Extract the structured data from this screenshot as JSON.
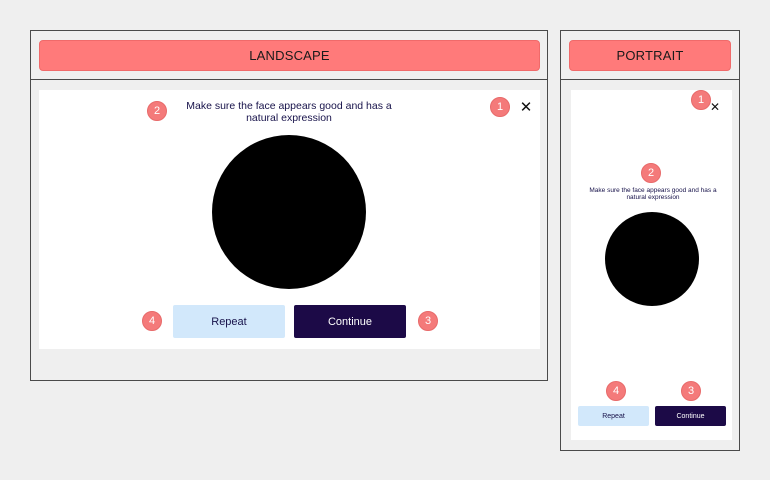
{
  "landscape": {
    "header_label": "LANDSCAPE",
    "close_glyph": "✕",
    "prompt": "Make sure the face appears good and has a natural expression",
    "repeat_label": "Repeat",
    "continue_label": "Continue",
    "markers": {
      "close": "1",
      "prompt": "2",
      "continue": "3",
      "repeat": "4"
    }
  },
  "portrait": {
    "header_label": "PORTRAIT",
    "close_glyph": "✕",
    "prompt": "Make sure the face appears good and has a natural expression",
    "repeat_label": "Repeat",
    "continue_label": "Continue",
    "markers": {
      "close": "1",
      "prompt": "2",
      "continue": "3",
      "repeat": "4"
    }
  },
  "colors": {
    "header": "#ff7a7a",
    "marker": "#f47a7a",
    "repeat_button": "#d2e8fb",
    "continue_button": "#1c0a47",
    "face_placeholder": "#000000",
    "prompt_text": "#17124a"
  },
  "icons": {
    "close": "close-icon"
  }
}
